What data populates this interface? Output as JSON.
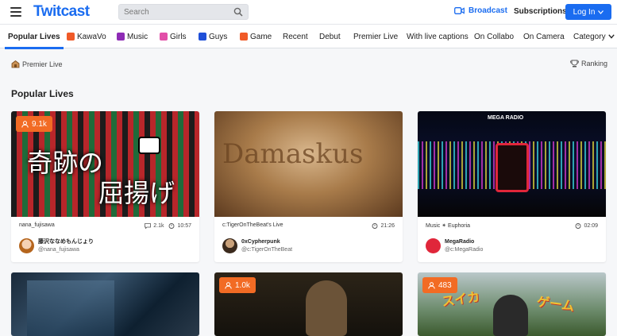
{
  "header": {
    "logo": "Twitcast",
    "search_placeholder": "Search",
    "broadcast": "Broadcast",
    "subscriptions": "Subscriptions",
    "login": "Log In"
  },
  "nav": {
    "tabs": [
      {
        "label": "Popular Lives",
        "active": true,
        "icon": ""
      },
      {
        "label": "KawaVo",
        "icon": "kawavo-icon",
        "color": "#f05a28"
      },
      {
        "label": "Music",
        "icon": "music-icon",
        "color": "#8e2bb5"
      },
      {
        "label": "Girls",
        "icon": "girls-icon",
        "color": "#e24fa8"
      },
      {
        "label": "Guys",
        "icon": "guys-icon",
        "color": "#1f4fd8"
      },
      {
        "label": "Game",
        "icon": "game-icon",
        "color": "#f05a28"
      },
      {
        "label": "Recent"
      },
      {
        "label": "Debut"
      },
      {
        "label": "Premier Live"
      },
      {
        "label": "With live captions"
      },
      {
        "label": "On Collabo"
      },
      {
        "label": "On Camera"
      },
      {
        "label": "Category"
      }
    ]
  },
  "premier_live": "Premier Live",
  "ranking": "Ranking",
  "section_title": "Popular Lives",
  "cards": [
    {
      "viewers": "9.1k",
      "category": "nana_fujisawa",
      "comments": "2.1k",
      "duration": "10:57",
      "owner_name": "藤沢ななめもんじょり",
      "owner_handle": "@nana_fujisawa",
      "thumb_text_1": "奇跡の",
      "thumb_text_2": "屈揚げ"
    },
    {
      "viewers": "",
      "category": "c:TigerOnTheBeat's Live",
      "comments": "",
      "duration": "21:26",
      "owner_name": "0xCypherpunk",
      "owner_handle": "@c:TigerOnTheBeat",
      "thumb_text_1": "Damaskus"
    },
    {
      "viewers": "",
      "category": "Music ✴ Euphoria",
      "comments": "",
      "duration": "02:09",
      "owner_name": "MegaRadio",
      "owner_handle": "@c:MegaRadio",
      "thumb_text_1": "MEGA RADIO"
    },
    {
      "viewers": "",
      "category": "",
      "comments": "",
      "duration": "",
      "owner_name": "",
      "owner_handle": ""
    },
    {
      "viewers": "1.0k",
      "category": "",
      "comments": "",
      "duration": "",
      "owner_name": "",
      "owner_handle": ""
    },
    {
      "viewers": "483",
      "category": "",
      "comments": "",
      "duration": "",
      "owner_name": "",
      "owner_handle": "",
      "thumb_text_1": "スイカ",
      "thumb_text_2": "ゲーム"
    }
  ],
  "colors": {
    "brand": "#1a6cf0",
    "viewer_badge": "#f26b24"
  }
}
